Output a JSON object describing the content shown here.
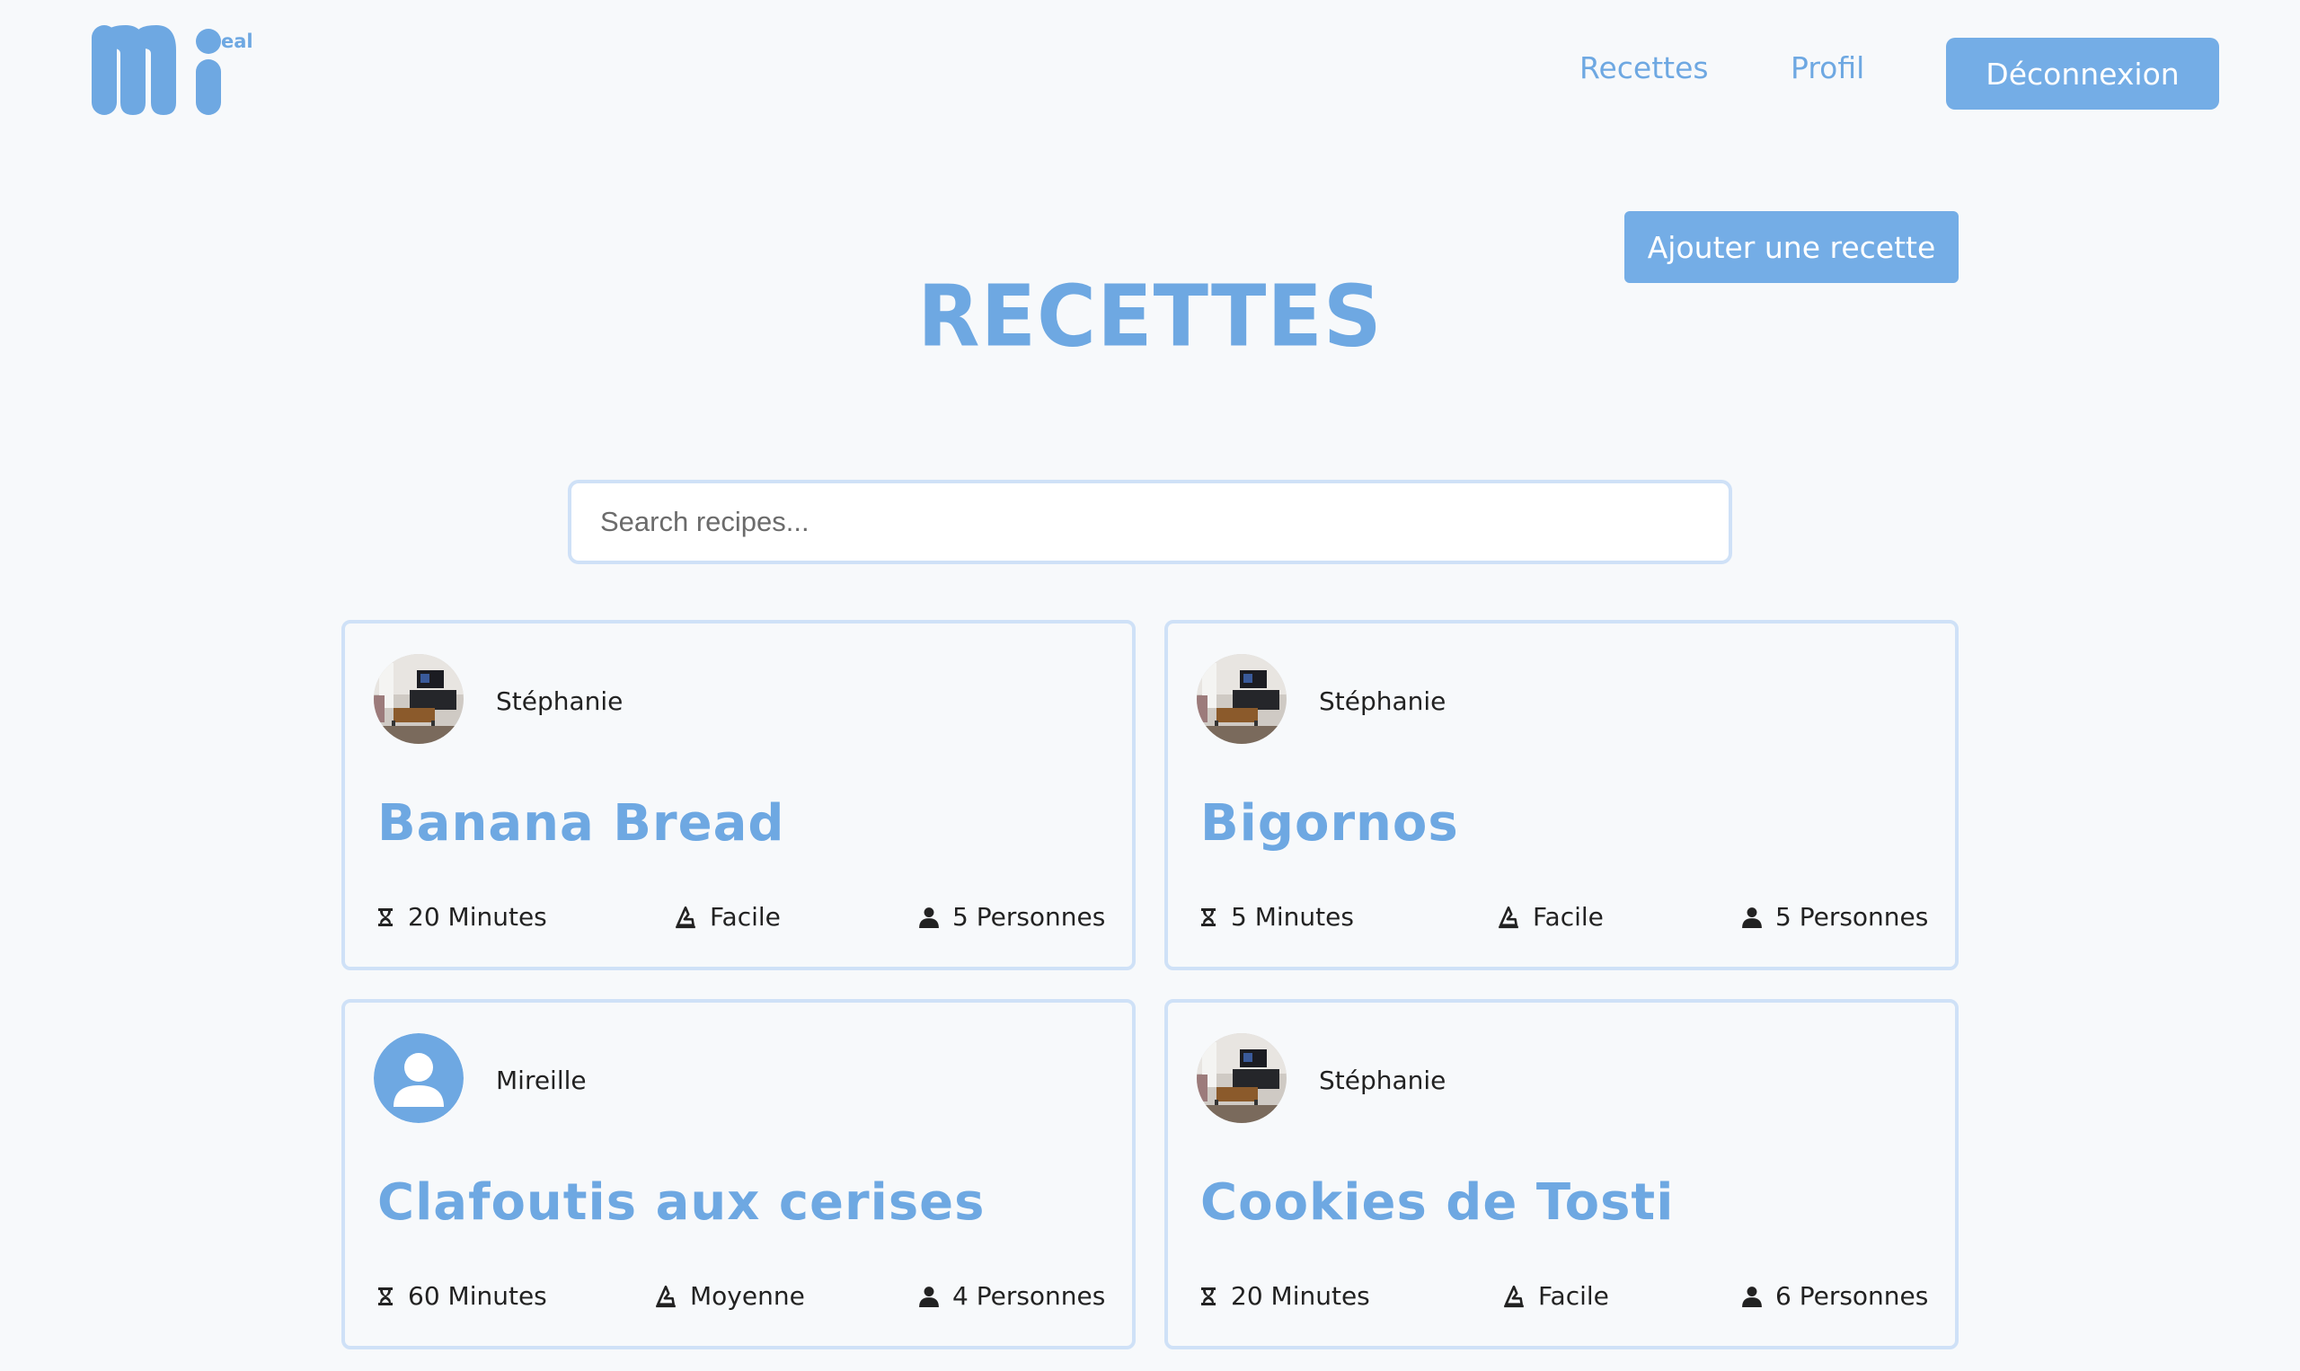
{
  "brand": {
    "logo_letters": "mi",
    "logo_tag": "eal",
    "color": "#6ea8e2"
  },
  "nav": {
    "links": [
      "Recettes",
      "Profil"
    ],
    "logout_label": "Déconnexion"
  },
  "main": {
    "add_button_label": "Ajouter une recette",
    "title": "RECETTES",
    "search_placeholder": "Search recipes..."
  },
  "recipes": [
    {
      "author": "Stéphanie",
      "avatar": "room-photo",
      "title": "Banana Bread",
      "time": "20 Minutes",
      "difficulty": "Facile",
      "servings": "5 Personnes"
    },
    {
      "author": "Stéphanie",
      "avatar": "room-photo",
      "title": "Bigornos",
      "time": "5 Minutes",
      "difficulty": "Facile",
      "servings": "5 Personnes"
    },
    {
      "author": "Mireille",
      "avatar": "default-user-icon",
      "title": "Clafoutis aux cerises",
      "time": "60 Minutes",
      "difficulty": "Moyenne",
      "servings": "4 Personnes"
    },
    {
      "author": "Stéphanie",
      "avatar": "room-photo",
      "title": "Cookies de Tosti",
      "time": "20 Minutes",
      "difficulty": "Facile",
      "servings": "6 Personnes"
    }
  ],
  "colors": {
    "accent": "#6ea8e2",
    "button": "#74ade6",
    "card_border": "#cfe1f7",
    "background": "#f7f9fb"
  }
}
